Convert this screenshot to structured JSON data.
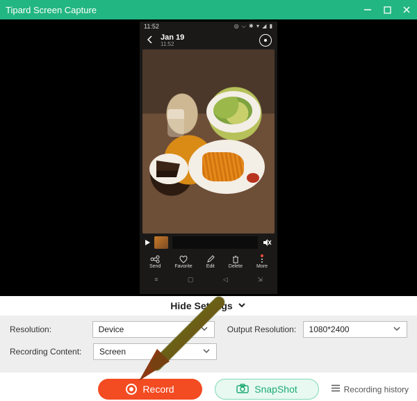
{
  "window": {
    "title": "Tipard Screen Capture"
  },
  "phone": {
    "status_time": "11:52",
    "date_line1": "Jan 19",
    "date_line2": "11:52",
    "actions": [
      "Send",
      "Favorite",
      "Edit",
      "Delete",
      "More"
    ]
  },
  "settings": {
    "toggle_label": "Hide Settings",
    "resolution_label": "Resolution:",
    "resolution_value": "Device",
    "recording_content_label": "Recording Content:",
    "recording_content_value": "Screen",
    "output_resolution_label": "Output Resolution:",
    "output_resolution_value": "1080*2400"
  },
  "actions": {
    "record_label": "Record",
    "snapshot_label": "SnapShot",
    "history_label": "Recording history"
  },
  "colors": {
    "primary": "#22b683",
    "record": "#f34b22"
  }
}
